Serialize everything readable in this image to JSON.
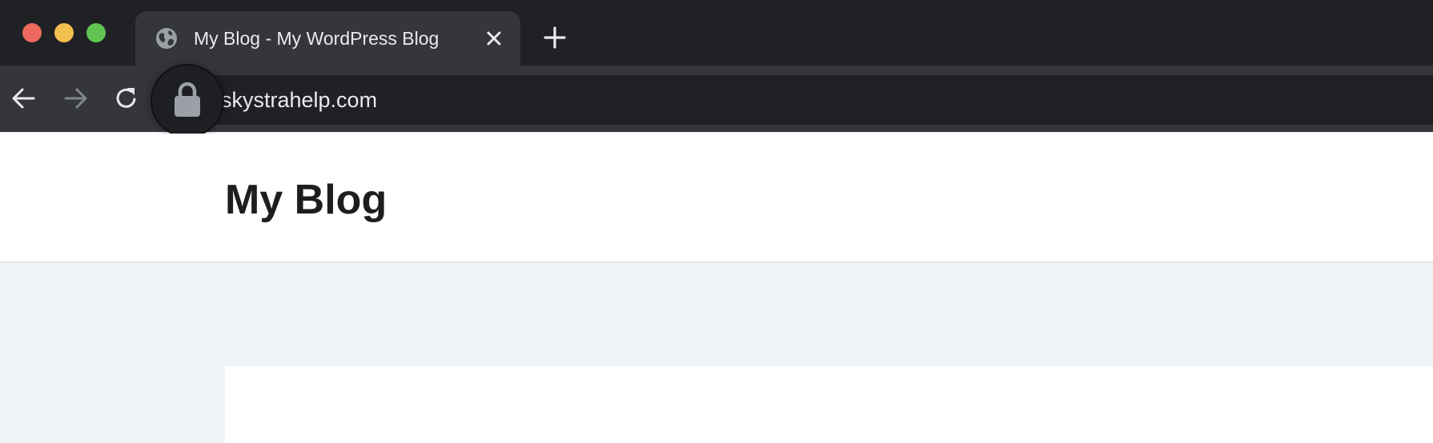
{
  "window": {
    "controls": [
      "close",
      "minimize",
      "maximize"
    ],
    "colors": {
      "close": "#ec6a5e",
      "minimize": "#f4bf4f",
      "maximize": "#61c554"
    }
  },
  "tab": {
    "title": "My Blog - My WordPress Blog",
    "favicon": "globe-icon",
    "close_icon": "close-icon"
  },
  "new_tab_icon": "plus-icon",
  "toolbar": {
    "back_icon": "arrow-left-icon",
    "forward_icon": "arrow-right-icon",
    "reload_icon": "reload-icon",
    "forward_enabled": false
  },
  "address_bar": {
    "url": "skystrahelp.com",
    "security_icon": "lock-icon"
  },
  "site": {
    "title": "My Blog",
    "background": "#f0f3f8"
  }
}
